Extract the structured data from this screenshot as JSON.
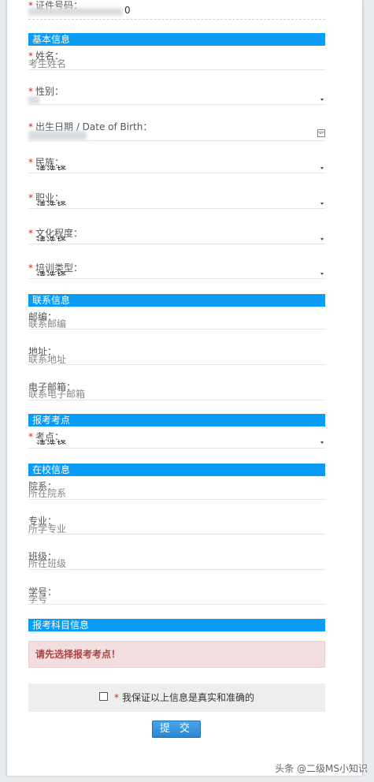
{
  "id_field": {
    "label": "证件号码：",
    "value_tail": "0"
  },
  "sections": {
    "basic": "基本信息",
    "contact": "联系信息",
    "exam_site": "报考考点",
    "school": "在校信息",
    "subjects": "报考科目信息"
  },
  "fields": {
    "name": {
      "label": "姓名：",
      "placeholder": "考生姓名"
    },
    "gender": {
      "label": "性别："
    },
    "birth": {
      "label": "出生日期 / Date of Birth："
    },
    "ethnicity": {
      "label": "民族：",
      "selected": "- 请选择 -"
    },
    "occupation": {
      "label": "职业：",
      "selected": "- 请选择 -"
    },
    "education": {
      "label": "文化程度：",
      "selected": "- 请选择 -"
    },
    "training": {
      "label": "培训类型：",
      "selected": "- 请选择 -"
    },
    "postcode": {
      "label": "邮编：",
      "placeholder": "联系邮编"
    },
    "address": {
      "label": "地址：",
      "placeholder": "联系地址"
    },
    "email": {
      "label": "电子邮箱：",
      "placeholder": "联系电子邮箱"
    },
    "exam_site": {
      "label": "考点：",
      "selected": "- 请选择 -"
    },
    "department": {
      "label": "院系：",
      "placeholder": "所在院系"
    },
    "major": {
      "label": "专业：",
      "placeholder": "所学专业"
    },
    "class": {
      "label": "班级：",
      "placeholder": "所在班级"
    },
    "student_id": {
      "label": "学号：",
      "placeholder": "学号"
    }
  },
  "alert": "请先选择报考考点！",
  "agreement": {
    "required_mark": "*",
    "text": "我保证以上信息是真实和准确的"
  },
  "submit_label": "提 交",
  "watermark": "头条 @二级MS小知识",
  "required_mark": "*"
}
